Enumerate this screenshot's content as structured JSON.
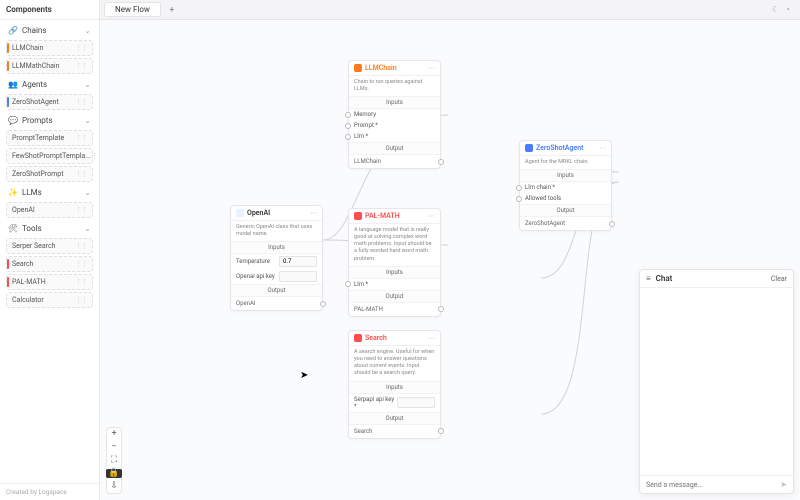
{
  "header": {
    "components_title": "Components",
    "tab_title": "New Flow"
  },
  "sidebar": {
    "groups": [
      {
        "label": "Chains",
        "items": [
          {
            "label": "LLMChain",
            "color": "orange"
          },
          {
            "label": "LLMMathChain",
            "color": "orange"
          }
        ]
      },
      {
        "label": "Agents",
        "items": [
          {
            "label": "ZeroShotAgent",
            "color": "blue"
          }
        ]
      },
      {
        "label": "Prompts",
        "items": [
          {
            "label": "PromptTemplate",
            "color": "none"
          },
          {
            "label": "FewShotPromptTempla...",
            "color": "none"
          },
          {
            "label": "ZeroShotPrompt",
            "color": "none"
          }
        ]
      },
      {
        "label": "LLMs",
        "items": [
          {
            "label": "OpenAI",
            "color": "none"
          }
        ]
      },
      {
        "label": "Tools",
        "items": [
          {
            "label": "Serper Search",
            "color": "none"
          },
          {
            "label": "Search",
            "color": "red"
          },
          {
            "label": "PAL-MATH",
            "color": "red"
          },
          {
            "label": "Calculator",
            "color": "none"
          }
        ]
      }
    ],
    "footer": "Created by Logspace"
  },
  "labels": {
    "inputs": "Inputs",
    "output": "Output"
  },
  "nodes": {
    "openai": {
      "title": "OpenAI",
      "desc": "Generic OpenAI class that uses model name.",
      "fields": {
        "temperature_label": "Temperature",
        "temperature_value": "0.7",
        "api_key_label": "Openai api key"
      },
      "out": "OpenAI"
    },
    "llmchain": {
      "title": "LLMChain",
      "desc": "Chain to run queries against LLMs.",
      "fields": {
        "memory": "Memory",
        "prompt": "Prompt *",
        "llm": "Llm *"
      },
      "out": "LLMChain"
    },
    "palmath": {
      "title": "PAL-MATH",
      "desc": "A language model that is really good at solving complex word math problems. Input should be a fully worded hard word math problem.",
      "fields": {
        "llm": "Llm *"
      },
      "out": "PAL-MATH"
    },
    "search": {
      "title": "Search",
      "desc": "A search engine. Useful for when you need to answer questions about current events. Input should be a search query.",
      "fields": {
        "api_key": "Serpapi api key *"
      },
      "out": "Search"
    },
    "zeroshot": {
      "title": "ZeroShotAgent",
      "desc": "Agent for the MRKL chain.",
      "fields": {
        "llm_chain": "Llm chain *",
        "allowed_tools": "Allowed tools"
      },
      "out": "ZeroShotAgent"
    }
  },
  "chat": {
    "title": "Chat",
    "clear": "Clear",
    "placeholder": "Send a message..."
  }
}
